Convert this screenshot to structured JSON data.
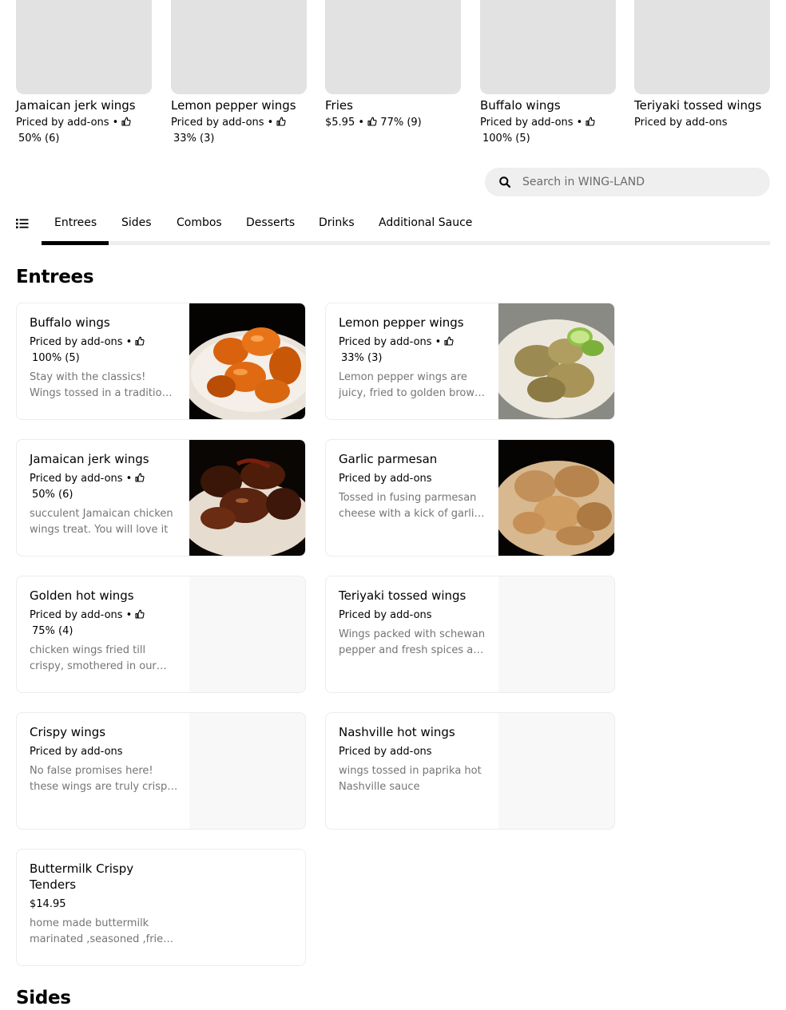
{
  "featured": [
    {
      "name": "Jamaican jerk wings",
      "price": "Priced by add-ons",
      "rating": "50% (6)"
    },
    {
      "name": "Lemon pepper wings",
      "price": "Priced by add-ons",
      "rating": "33% (3)"
    },
    {
      "name": "Fries",
      "price": "$5.95",
      "rating": "77% (9)"
    },
    {
      "name": "Buffalo wings",
      "price": "Priced by add-ons",
      "rating": "100% (5)"
    },
    {
      "name": "Teriyaki tossed wings",
      "price": "Priced by add-ons",
      "rating": ""
    }
  ],
  "search": {
    "placeholder": "Search in WING-LAND"
  },
  "tabs": [
    "Entrees",
    "Sides",
    "Combos",
    "Desserts",
    "Drinks",
    "Additional Sauce"
  ],
  "sections": {
    "entrees": "Entrees",
    "sides": "Sides"
  },
  "items": [
    {
      "name": "Buffalo wings",
      "price": "Priced by add-ons",
      "rating": "100% (5)",
      "desc": "Stay with the classics! Wings tossed in a traditional buffalo sauce",
      "image": "buffalo-wings-photo"
    },
    {
      "name": "Lemon pepper wings",
      "price": "Priced by add-ons",
      "rating": "33% (3)",
      "desc": "Lemon pepper wings are juicy, fried to golden brown perfection",
      "image": "lemon-pepper-wings-photo"
    },
    {
      "name": "Jamaican jerk wings",
      "price": "Priced by add-ons",
      "rating": "50% (6)",
      "desc": "succulent Jamaican chicken wings treat. You will love it",
      "image": "jerk-wings-photo"
    },
    {
      "name": "Garlic parmesan",
      "price": "Priced by add-ons",
      "rating": "",
      "desc": "Tossed in fusing parmesan cheese with a kick of garlic flavor",
      "image": "garlic-parmesan-photo"
    },
    {
      "name": "Golden hot wings",
      "price": "Priced by add-ons",
      "rating": "75% (4)",
      "desc": "chicken wings fried till crispy, smothered in our golden hot sauce",
      "image": ""
    },
    {
      "name": "Teriyaki tossed wings",
      "price": "Priced by add-ons",
      "rating": "",
      "desc": "Wings packed with schewan pepper and fresh spices and teriyaki",
      "image": ""
    },
    {
      "name": "Crispy wings",
      "price": "Priced by add-ons",
      "rating": "",
      "desc": "No false promises here! these wings are truly crispy and tasty",
      "image": ""
    },
    {
      "name": "Nashville hot wings",
      "price": "Priced by add-ons",
      "rating": "",
      "desc": "wings tossed in paprika hot Nashville sauce",
      "image": ""
    },
    {
      "name": "Buttermilk Crispy Tenders",
      "price": "$14.95",
      "rating": "",
      "desc": "home made buttermilk marinated ,seasoned ,fried tenders",
      "image": ""
    }
  ],
  "icons": {
    "thumbs_up": "thumbs-up-icon",
    "search": "search-icon",
    "menu_list": "list-icon"
  },
  "colors": {
    "accent": "#000000",
    "image_placeholder": "#e2e2e2",
    "description": "#757575"
  }
}
